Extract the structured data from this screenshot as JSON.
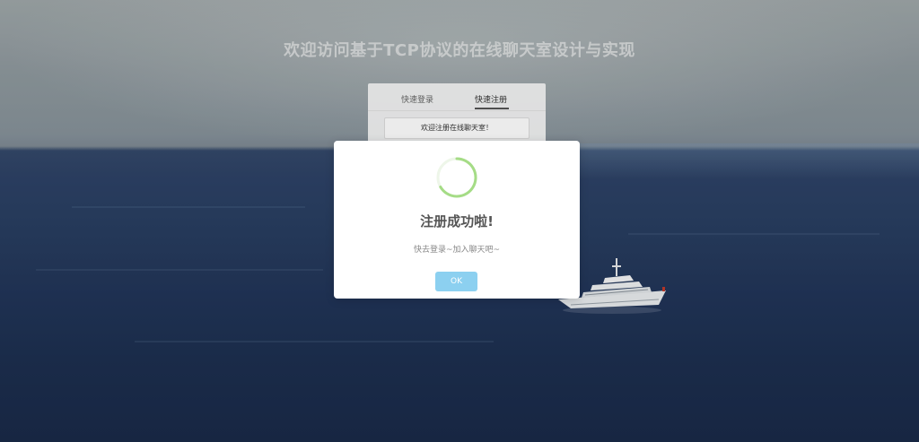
{
  "page": {
    "title": "欢迎访问基于TCP协议的在线聊天室设计与实现"
  },
  "auth_form": {
    "tabs": [
      {
        "label": "快速登录"
      },
      {
        "label": "快速注册"
      }
    ],
    "active_tab": "快速注册",
    "notice": "欢迎注册在线聊天室！"
  },
  "dialog": {
    "title": "注册成功啦!",
    "message": "快去登录~加入聊天吧~",
    "ok_label": "OK",
    "icon": "loading-spinner-icon",
    "spinner_color": "#a5dc86",
    "ok_color": "#8cd0f0"
  },
  "background": {
    "scene": "ocean-with-yacht"
  }
}
